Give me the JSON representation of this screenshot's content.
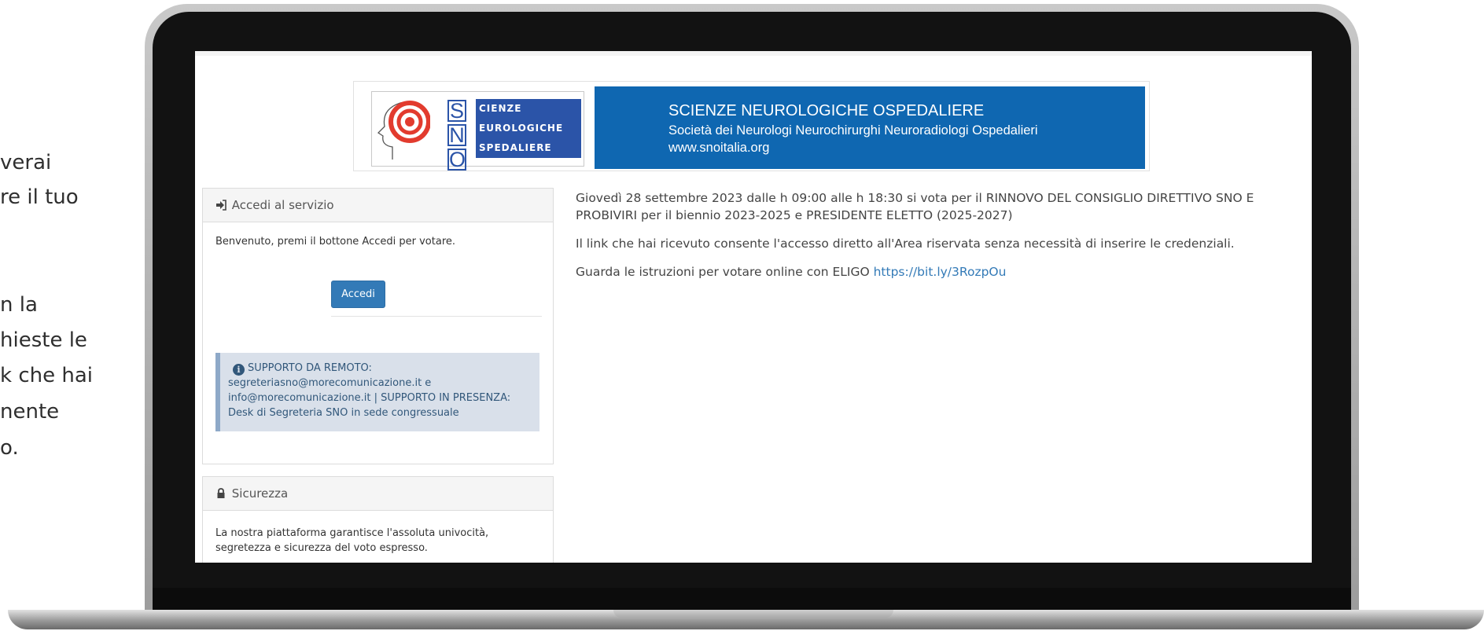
{
  "left_text": {
    "lines": [
      "verai",
      "re il tuo",
      "n la",
      "hieste le",
      "k che hai",
      "nente",
      "o."
    ]
  },
  "banner": {
    "logo_letters": [
      "S",
      "N",
      "O"
    ],
    "logo_words": [
      "CIENZE",
      "EUROLOGICHE",
      "SPEDALIERE"
    ],
    "title": "SCIENZE NEUROLOGICHE OSPEDALIERE",
    "subtitle": "Società dei Neurologi Neurochirurghi Neuroradiologi Ospedalieri",
    "url": "www.snoitalia.org",
    "color": "#0f67b1"
  },
  "login_panel": {
    "heading": "Accedi al servizio",
    "icon": "sign-in-icon",
    "welcome": "Benvenuto, premi il bottone Accedi per votare.",
    "button_label": "Accedi",
    "support_text": "SUPPORTO DA REMOTO: segreteriasno@morecomunicazione.it e info@morecomunicazione.it | SUPPORTO IN PRESENZA: Desk di Segreteria SNO in sede congressuale"
  },
  "security_panel": {
    "heading": "Sicurezza",
    "icon": "lock-icon",
    "text": "La nostra piattaforma garantisce l'assoluta univocità, segretezza e sicurezza del voto espresso."
  },
  "main": {
    "paragraph1": "Giovedì 28 settembre 2023 dalle h 09:00 alle h 18:30 si vota per il RINNOVO DEL CONSIGLIO DIRETTIVO SNO E PROBIVIRI per il biennio 2023-2025 e PRESIDENTE ELETTO (2025-2027)",
    "paragraph2": "Il link che hai ricevuto consente l'accesso diretto all'Area riservata senza necessità di inserire le credenziali.",
    "paragraph3_prefix": "Guarda le istruzioni per votare online con ELIGO ",
    "link": "https://bit.ly/3RozpOu"
  },
  "colors": {
    "primary_button": "#337ab7",
    "support_bg": "#d9e0ea"
  }
}
